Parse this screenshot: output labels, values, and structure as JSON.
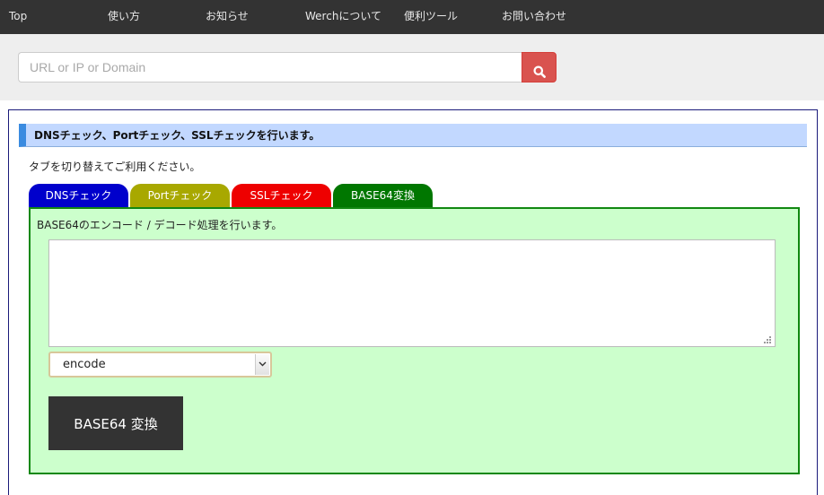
{
  "nav": {
    "items": [
      {
        "label": "Top"
      },
      {
        "label": "使い方"
      },
      {
        "label": "お知らせ"
      },
      {
        "label": "Werchについて"
      },
      {
        "label": "便利ツール"
      },
      {
        "label": "お問い合わせ"
      }
    ]
  },
  "search": {
    "placeholder": "URL or IP or Domain",
    "value": "",
    "icon": "search-icon"
  },
  "main": {
    "heading": "DNSチェック、Portチェック、SSLチェックを行います。",
    "instruction": "タブを切り替えてご利用ください。",
    "tabs": [
      {
        "label": "DNSチェック",
        "color": "#0000cc"
      },
      {
        "label": "Portチェック",
        "color": "#a8a800"
      },
      {
        "label": "SSLチェック",
        "color": "#ee0000"
      },
      {
        "label": "BASE64変換",
        "color": "#007700",
        "active": true
      }
    ],
    "content": {
      "description": "BASE64のエンコード / デコード処理を行います。",
      "textarea_value": "",
      "mode_selected": "encode",
      "convert_label": "BASE64 変換"
    }
  },
  "colors": {
    "nav_bg": "#333333",
    "search_button": "#d9534f",
    "heading_bg": "#c2d8ff",
    "heading_accent": "#3a8be0",
    "content_bg": "#ccffcc",
    "content_border": "#118811",
    "convert_button": "#333333"
  }
}
